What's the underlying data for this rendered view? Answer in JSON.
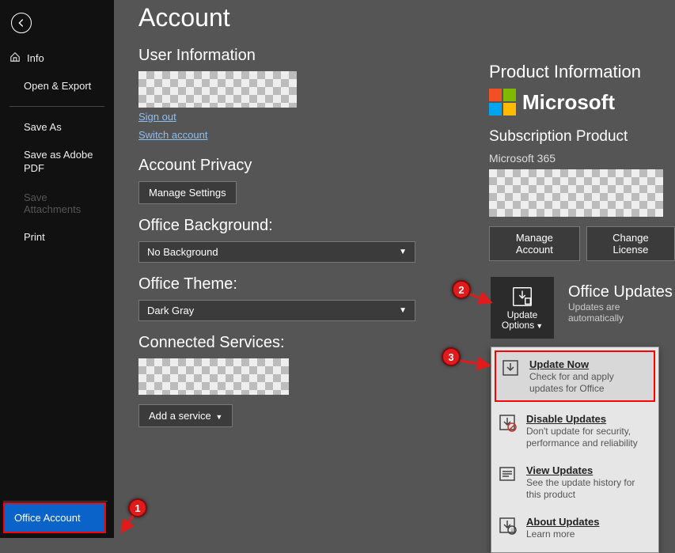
{
  "sidebar": {
    "info": "Info",
    "open_export": "Open & Export",
    "save_as": "Save As",
    "save_pdf": "Save as Adobe PDF",
    "attachments": "Save Attachments",
    "print": "Print",
    "office_account": "Office Account"
  },
  "page": {
    "title": "Account"
  },
  "user_info": {
    "heading": "User Information",
    "sign_out": "Sign out",
    "switch_account": "Switch account"
  },
  "privacy": {
    "heading": "Account Privacy",
    "manage": "Manage Settings"
  },
  "background": {
    "heading": "Office Background:",
    "value": "No Background"
  },
  "theme": {
    "heading": "Office Theme:",
    "value": "Dark Gray"
  },
  "services": {
    "heading": "Connected Services:",
    "add": "Add a service"
  },
  "product": {
    "heading": "Product Information",
    "brand": "Microsoft",
    "sub_heading": "Subscription Product",
    "sub_name": "Microsoft 365",
    "manage_account": "Manage Account",
    "change_license": "Change License"
  },
  "updates": {
    "button_label1": "Update",
    "button_label2": "Options",
    "heading": "Office Updates",
    "caption": "Updates are automatically"
  },
  "popup": {
    "items": [
      {
        "title": "Update Now",
        "desc": "Check for and apply updates for Office"
      },
      {
        "title": "Disable Updates",
        "desc": "Don't update for security, performance and reliability"
      },
      {
        "title": "View Updates",
        "desc": "See the update history for this product"
      },
      {
        "title": "About Updates",
        "desc": "Learn more"
      }
    ]
  },
  "badges": {
    "b1": "1",
    "b2": "2",
    "b3": "3"
  }
}
